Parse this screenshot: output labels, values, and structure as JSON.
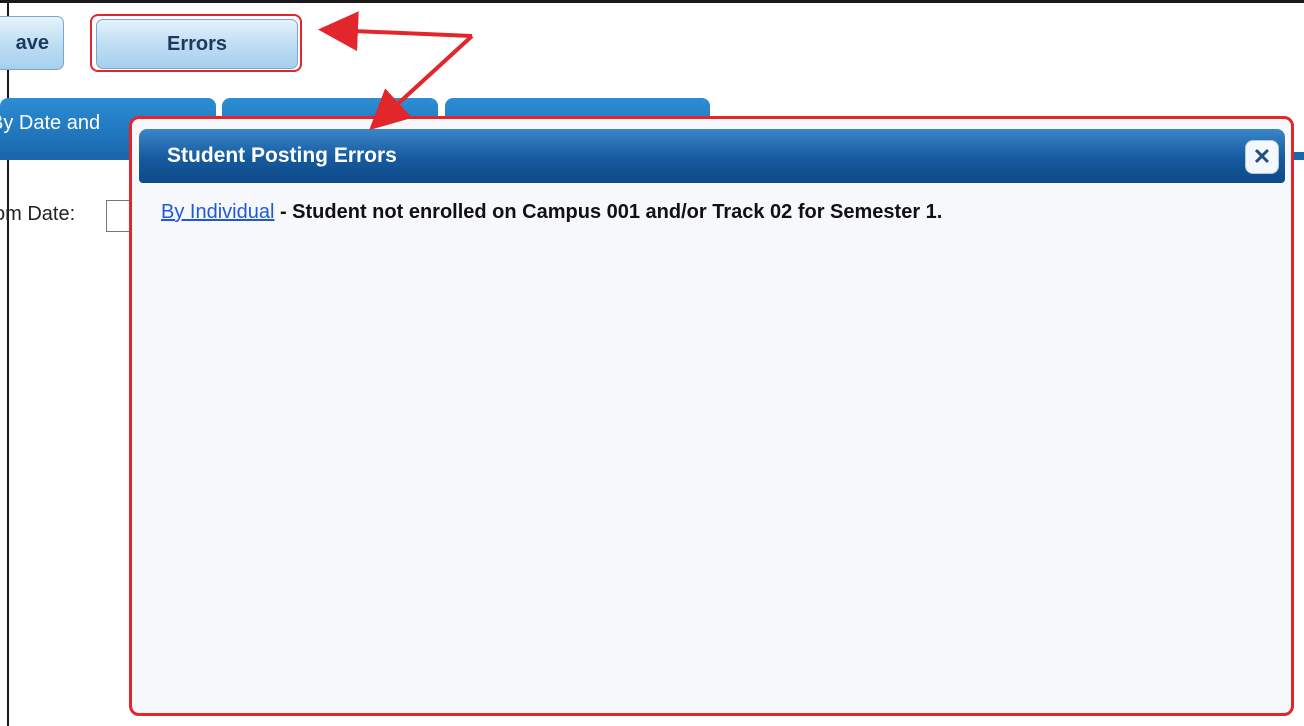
{
  "toolbar": {
    "save_label": "ave",
    "errors_label": "Errors"
  },
  "tabs": [
    {
      "label": "By Date and"
    },
    {
      "label": ""
    },
    {
      "label": ""
    }
  ],
  "form": {
    "from_date_label": "om Date:",
    "from_date_value": ""
  },
  "dialog": {
    "title": "Student Posting Errors",
    "close_icon": "close-icon",
    "error": {
      "link_text": "By Individual",
      "message": " - Student not enrolled on Campus 001 and/or Track 02 for Semester 1."
    }
  },
  "colors": {
    "accent": "#1a67ad",
    "annotation_red": "#e3262c",
    "link_blue": "#1f58d8"
  }
}
